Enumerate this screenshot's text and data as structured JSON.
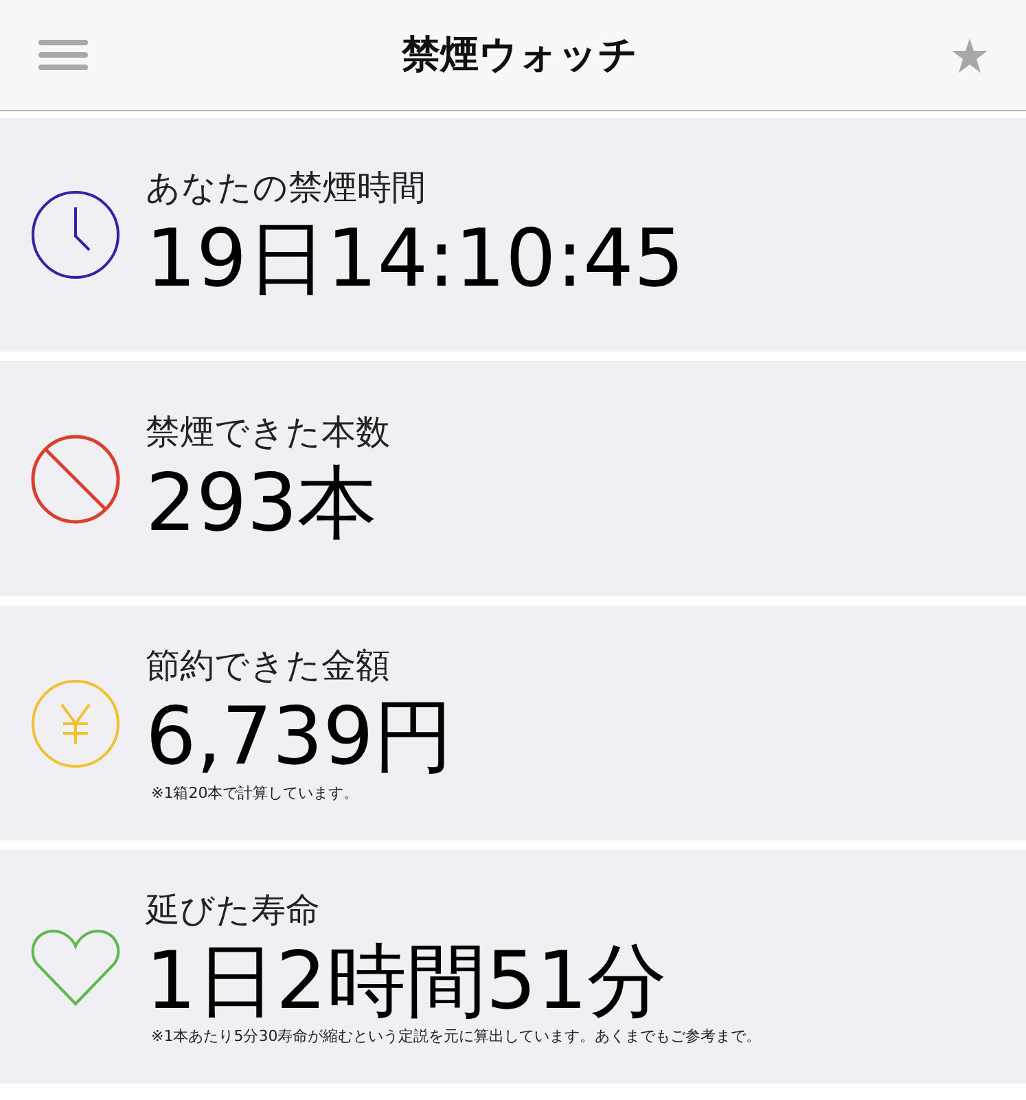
{
  "header": {
    "title": "禁煙ウォッチ"
  },
  "stats": [
    {
      "kind": "clock",
      "color": "#3b1fa6",
      "label": "あなたの禁煙時間",
      "value": "19日14:10:45"
    },
    {
      "kind": "prohibited",
      "color": "#d9412f",
      "label": "禁煙できた本数",
      "value": "293本"
    },
    {
      "kind": "yen",
      "color": "#f0c232",
      "label": "節約できた金額",
      "value": "6,739円",
      "note": "※1箱20本で計算しています。"
    },
    {
      "kind": "heart",
      "color": "#5db94b",
      "label": "延びた寿命",
      "value": "1日2時間51分",
      "note": "※1本あたり5分30寿命が縮むという定説を元に算出しています。あくまでもご参考まで。"
    }
  ]
}
